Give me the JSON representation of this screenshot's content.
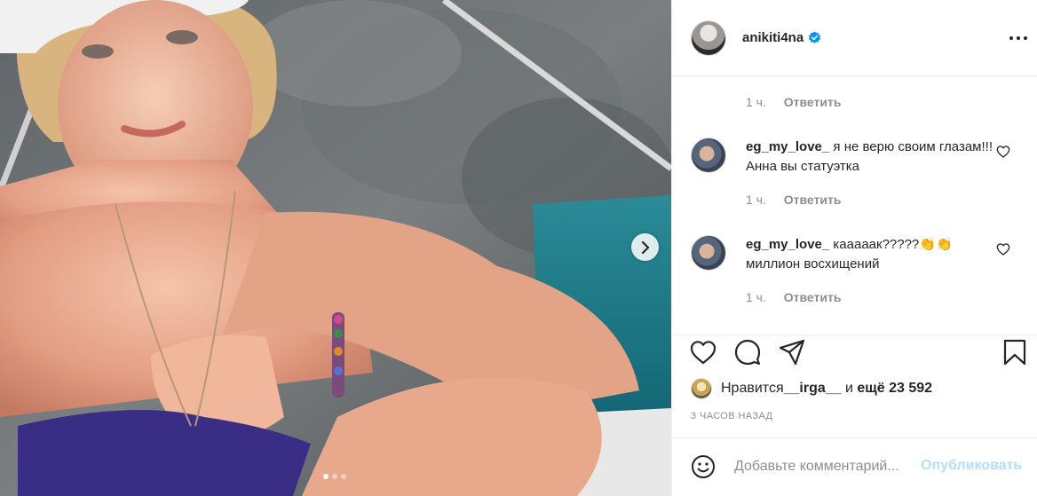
{
  "post": {
    "carousel_dots": 3,
    "active_dot": 0
  },
  "header": {
    "username": "anikiti4na",
    "verified": true
  },
  "comments": {
    "prev_reply": {
      "time": "1 ч.",
      "reply_label": "Ответить"
    },
    "items": [
      {
        "username": "eg_my_love_",
        "text": " я не верю своим глазам!!! Анна вы статуэтка",
        "time": "1 ч.",
        "reply_label": "Ответить"
      },
      {
        "username": "eg_my_love_",
        "text": " кааааак?????👏👏 миллион восхищений",
        "time": "1 ч.",
        "reply_label": "Ответить"
      }
    ]
  },
  "likes": {
    "prefix": "Нравится ",
    "user": "__irga__",
    "middle": " и ",
    "count": "ещё 23 592"
  },
  "time_ago": "3 ЧАСОВ НАЗАД",
  "add_comment": {
    "placeholder": "Добавьте комментарий...",
    "publish_label": "Опубликовать"
  },
  "colors": {
    "accent": "#0095f6",
    "publish_disabled": "#b2dffc",
    "muted": "#8e8e8e",
    "swimsuit": "#3a2d86",
    "sea": "#1d7f8c"
  }
}
